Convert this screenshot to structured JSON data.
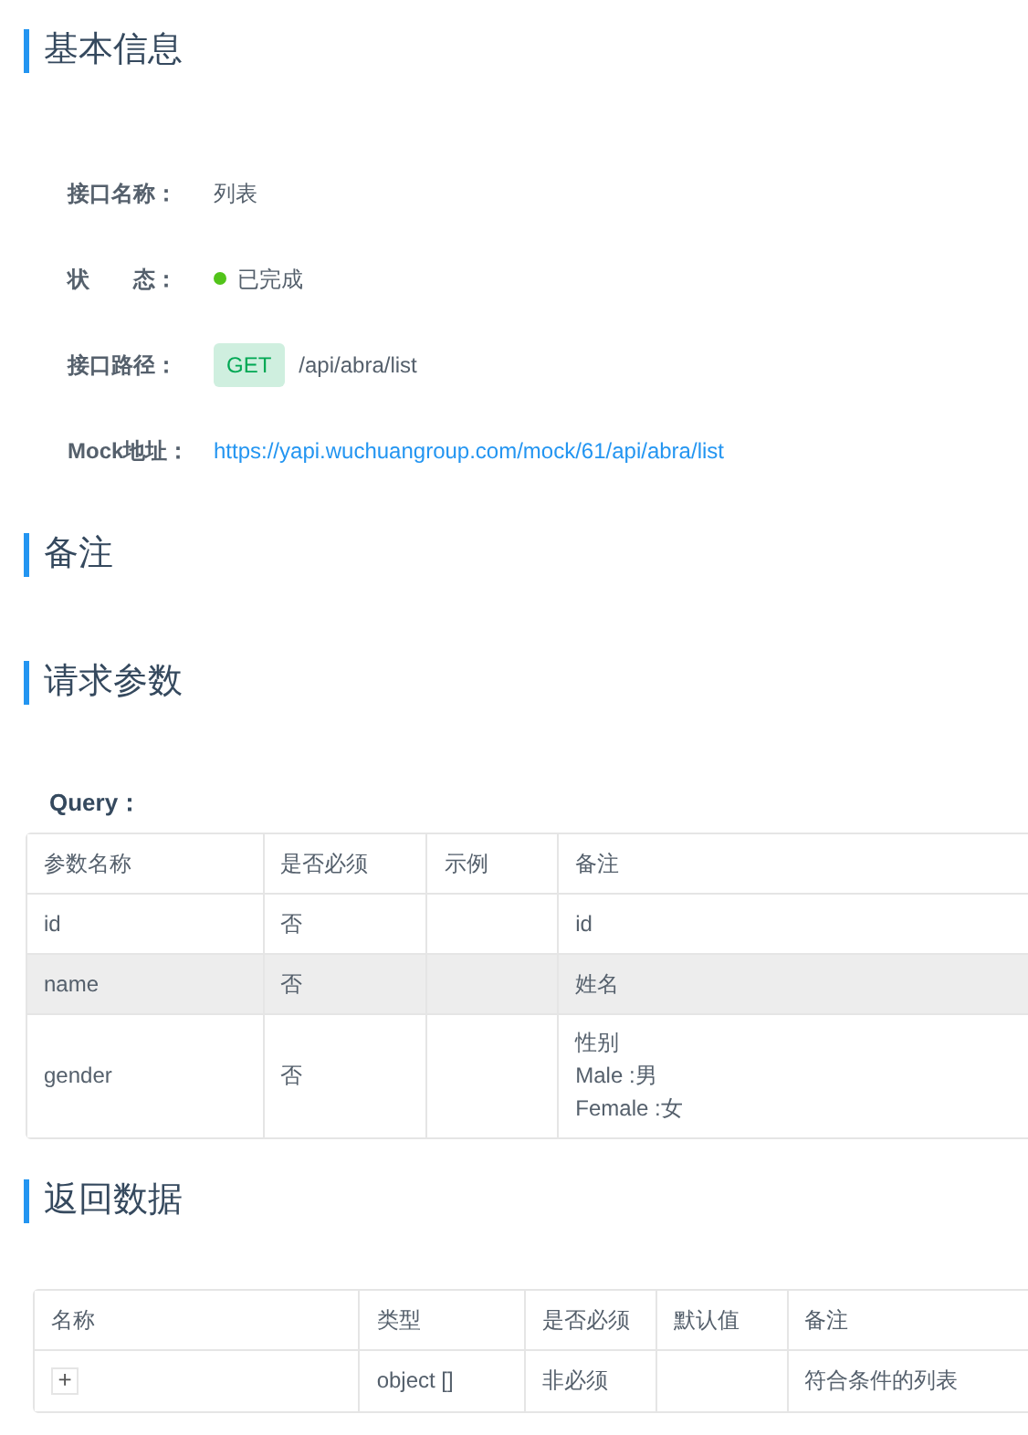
{
  "basic_info": {
    "title": "基本信息",
    "fields": [
      {
        "kind": "text",
        "label": "接口名称：",
        "value": "列表"
      },
      {
        "kind": "status",
        "label": "状　　态：",
        "value": "已完成",
        "color": "#52c41a"
      },
      {
        "kind": "path",
        "label": "接口路径：",
        "method": "GET",
        "value": "/api/abra/list"
      },
      {
        "kind": "link",
        "label": "Mock地址：",
        "value": "https://yapi.wuchuangroup.com/mock/61/api/abra/list"
      }
    ]
  },
  "remarks": {
    "title": "备注"
  },
  "request_params": {
    "title": "请求参数",
    "query_label": "Query：",
    "columns": [
      "参数名称",
      "是否必须",
      "示例",
      "备注"
    ],
    "rows": [
      {
        "highlighted": false,
        "cells": [
          "id",
          "否",
          "",
          [
            "id"
          ]
        ]
      },
      {
        "highlighted": true,
        "cells": [
          "name",
          "否",
          "",
          [
            "姓名"
          ]
        ]
      },
      {
        "highlighted": false,
        "cells": [
          "gender",
          "否",
          "",
          [
            "性别",
            "Male :男",
            "Female :女"
          ]
        ]
      }
    ]
  },
  "response": {
    "title": "返回数据",
    "columns": [
      "名称",
      "类型",
      "是否必须",
      "默认值",
      "备注"
    ],
    "rows": [
      {
        "cells": [
          "+",
          "object []",
          "非必须",
          "",
          "符合条件的列表"
        ]
      }
    ]
  }
}
